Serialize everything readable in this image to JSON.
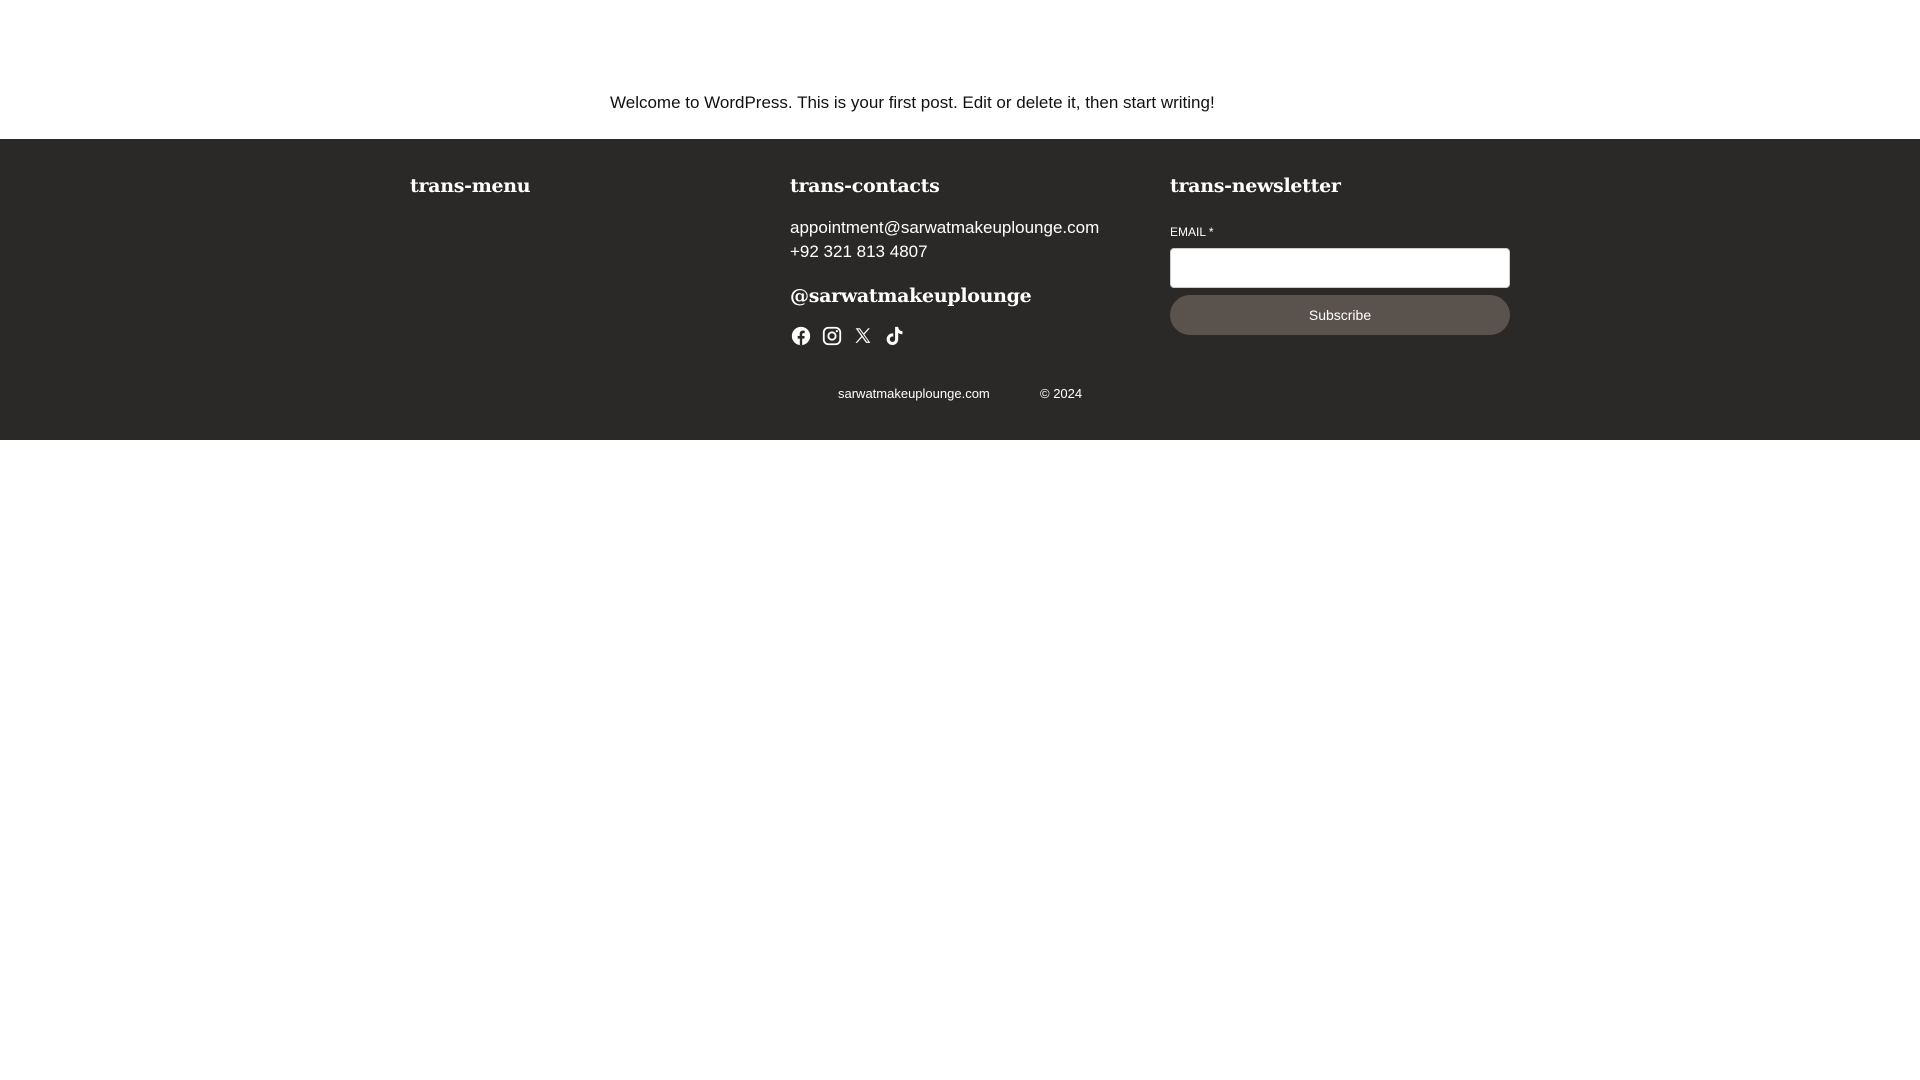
{
  "post": {
    "text": "Welcome to WordPress. This is your first post. Edit or delete it, then start writing!"
  },
  "footer": {
    "menu": {
      "title": "trans-menu"
    },
    "contacts": {
      "title": "trans-contacts",
      "email": "appointment@sarwatmakeuplounge.com",
      "phone": "+92 321 813 4807",
      "handle": "@sarwatmakeuplounge",
      "social_icons": [
        "facebook-icon",
        "instagram-icon",
        "x-icon",
        "tiktok-icon"
      ]
    },
    "newsletter": {
      "title": "trans-newsletter",
      "email_label": "EMAIL *",
      "email_value": "",
      "subscribe_label": "Subscribe"
    },
    "site": "sarwatmakeuplounge.com",
    "copyright": "© 2024"
  },
  "colors": {
    "footer_bg": "#2b2927",
    "button_bg": "#5a524d",
    "text_light": "#ffffff"
  }
}
